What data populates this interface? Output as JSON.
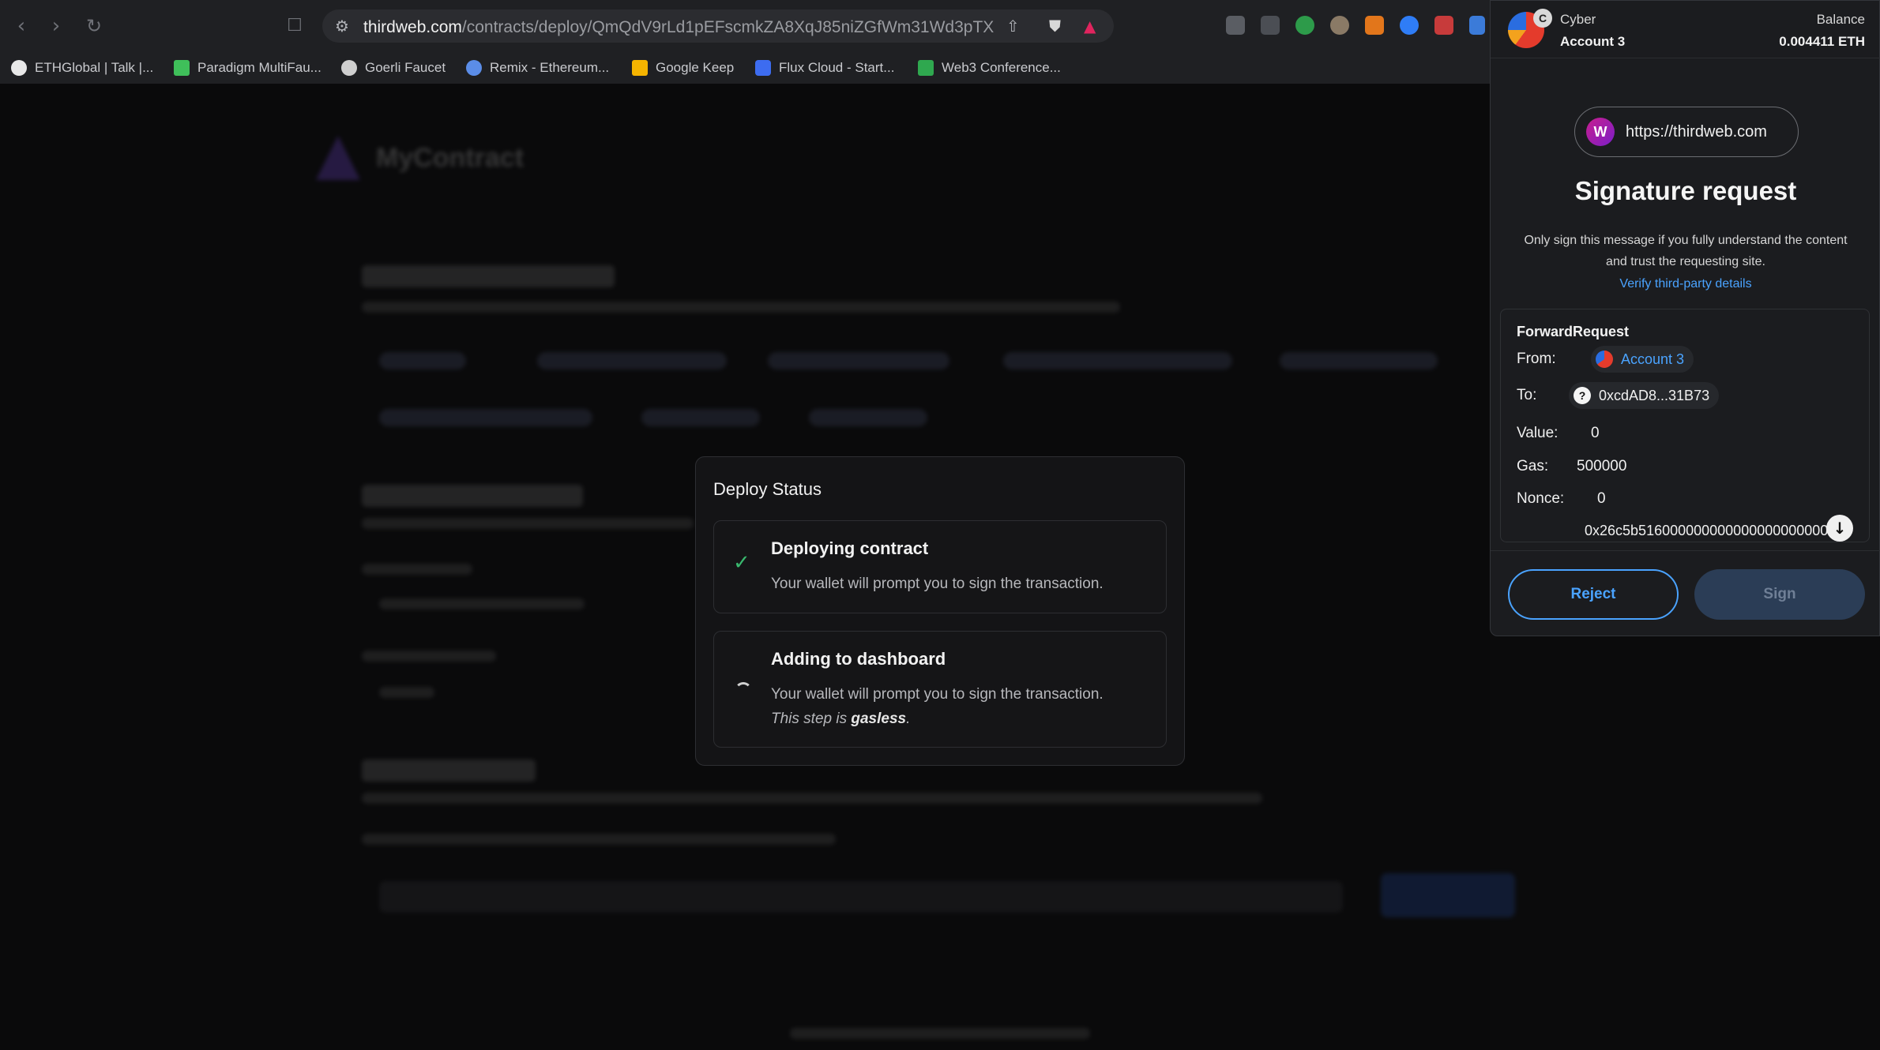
{
  "browser": {
    "url_host": "thirdweb.com",
    "url_path": "/contracts/deploy/QmQdV9rLd1pEFscmkZA8XqJ85niZGfWm31Wd3pTX...",
    "bookmarks": [
      {
        "label": "ETHGlobal | Talk |...",
        "color": "#e8e8e8"
      },
      {
        "label": "Paradigm MultiFau...",
        "color": "#3fbf5a"
      },
      {
        "label": "Goerli Faucet",
        "color": "#cfcfcf"
      },
      {
        "label": "Remix - Ethereum...",
        "color": "#5b8de8"
      },
      {
        "label": "Google Keep",
        "color": "#f5b400"
      },
      {
        "label": "Flux Cloud - Start...",
        "color": "#3d6cf0"
      },
      {
        "label": "Web3 Conference...",
        "color": "#2fa84f"
      }
    ]
  },
  "page": {
    "contract_name": "MyContract"
  },
  "deploy_modal": {
    "title": "Deploy Status",
    "steps": [
      {
        "title": "Deploying contract",
        "desc": "Your wallet will prompt you to sign the transaction.",
        "status": "done"
      },
      {
        "title": "Adding to dashboard",
        "desc": "Your wallet will prompt you to sign the transaction.",
        "note_prefix": "This step is ",
        "note_bold": "gasless",
        "note_suffix": ".",
        "status": "loading"
      }
    ]
  },
  "wallet": {
    "network": "Cyber",
    "account": "Account 3",
    "balance_label": "Balance",
    "balance": "0.004411 ETH",
    "origin": "https://thirdweb.com",
    "title": "Signature request",
    "warning": "Only sign this message if you fully understand the content and trust the requesting site.",
    "verify_link": "Verify third-party details",
    "message": {
      "type": "ForwardRequest",
      "from_label": "From:",
      "from_value": "Account 3",
      "to_label": "To:",
      "to_value": "0xcdAD8...31B73",
      "value_label": "Value:",
      "value_value": "0",
      "gas_label": "Gas:",
      "gas_value": "500000",
      "nonce_label": "Nonce:",
      "nonce_value": "0",
      "data_value": "0x26c5b516000000000000000000000000"
    },
    "reject_label": "Reject",
    "sign_label": "Sign"
  }
}
